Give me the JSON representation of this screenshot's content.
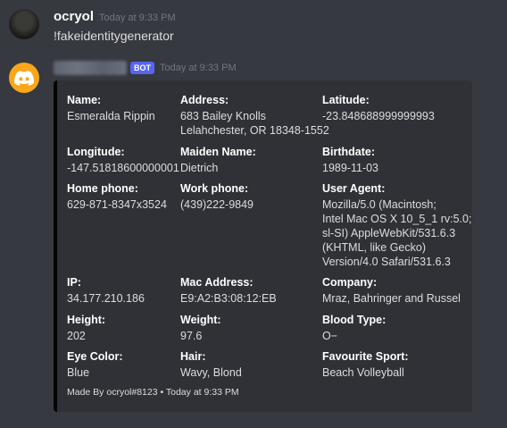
{
  "user_message": {
    "username": "ocryol",
    "timestamp": "Today at 9:33 PM",
    "content": "!fakeidentitygenerator"
  },
  "bot_message": {
    "bot_tag": "BOT",
    "timestamp": "Today at 9:33 PM",
    "embed": {
      "border_color": "#040405",
      "fields": [
        {
          "name": "Name:",
          "value": "Esmeralda Rippin"
        },
        {
          "name": "Address:",
          "value": "683 Bailey Knolls\nLelahchester, OR 18348-1552"
        },
        {
          "name": "Latitude:",
          "value": "-23.848688999999993"
        },
        {
          "name": "Longitude:",
          "value": "-147.51818600000001"
        },
        {
          "name": "Maiden Name:",
          "value": "Dietrich"
        },
        {
          "name": "Birthdate:",
          "value": "1989-11-03"
        },
        {
          "name": "Home phone:",
          "value": "629-871-8347x3524"
        },
        {
          "name": "Work phone:",
          "value": "(439)222-9849"
        },
        {
          "name": "User Agent:",
          "value": "Mozilla/5.0 (Macintosh;\nIntel Mac OS X 10_5_1 rv:5.0;\nsl-SI) AppleWebKit/531.6.3\n(KHTML, like Gecko)\nVersion/4.0 Safari/531.6.3"
        },
        {
          "name": "IP:",
          "value": "34.177.210.186"
        },
        {
          "name": "Mac Address:",
          "value": "E9:A2:B3:08:12:EB"
        },
        {
          "name": "Company:",
          "value": "Mraz, Bahringer and Russel"
        },
        {
          "name": "Height:",
          "value": "202"
        },
        {
          "name": "Weight:",
          "value": "97.6"
        },
        {
          "name": "Blood Type:",
          "value": "O−"
        },
        {
          "name": "Eye Color:",
          "value": "Blue"
        },
        {
          "name": "Hair:",
          "value": "Wavy, Blond"
        },
        {
          "name": "Favourite Sport:",
          "value": "Beach Volleyball"
        }
      ],
      "footer": "Made By ocryol#8123 • Today at 9:33 PM"
    }
  },
  "colors": {
    "background": "#36393f",
    "embed_background": "#2f3136",
    "bot_tag": "#5865f2",
    "bot_avatar": "#faa61a"
  },
  "icons": {
    "user_avatar": "user-avatar",
    "bot_avatar": "discord-logo-icon"
  }
}
